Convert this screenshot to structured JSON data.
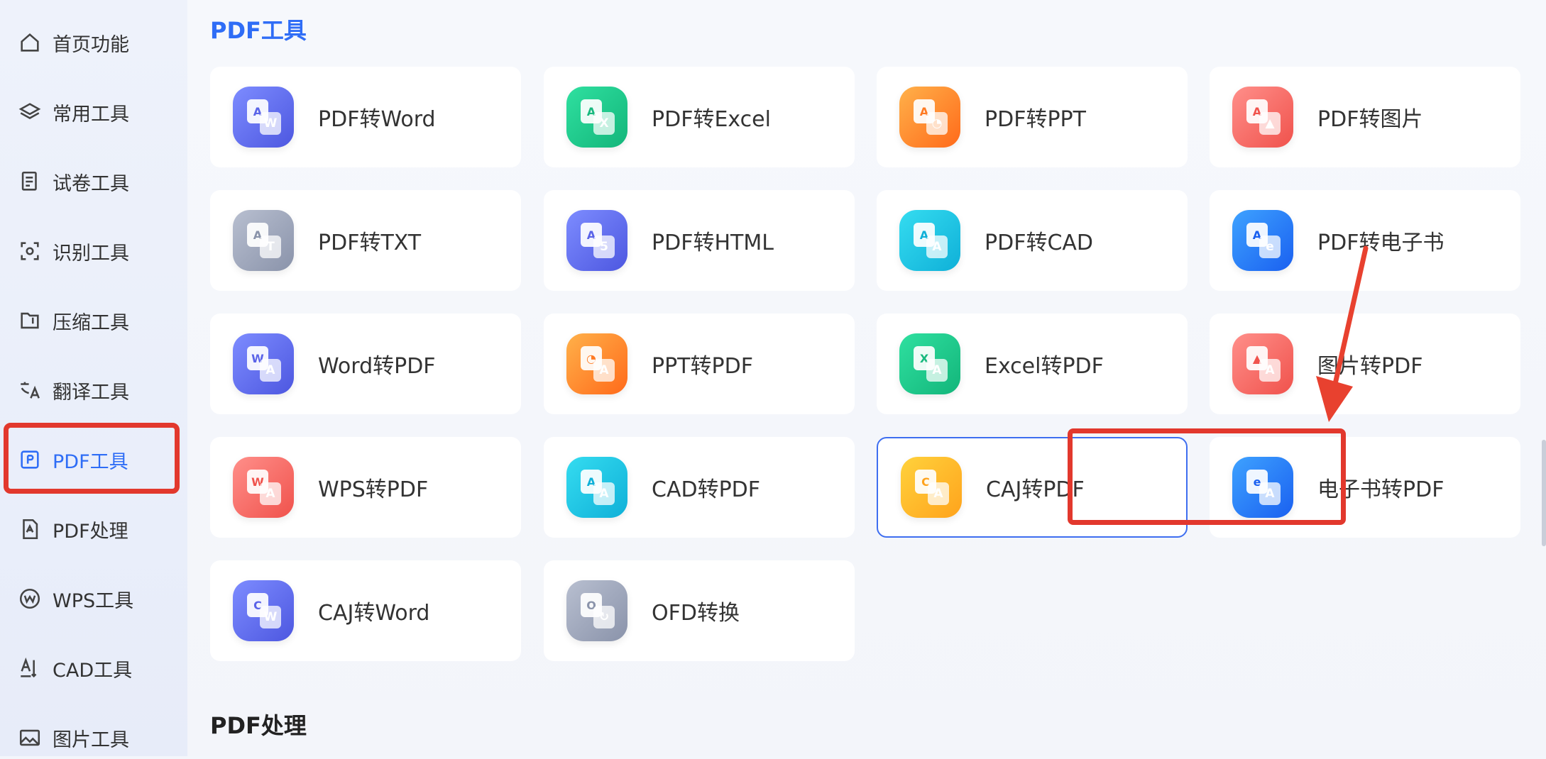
{
  "sidebar": {
    "items": [
      {
        "label": "首页功能",
        "icon": "home-icon"
      },
      {
        "label": "常用工具",
        "icon": "layers-icon"
      },
      {
        "label": "试卷工具",
        "icon": "exam-icon"
      },
      {
        "label": "识别工具",
        "icon": "scan-icon"
      },
      {
        "label": "压缩工具",
        "icon": "compress-icon"
      },
      {
        "label": "翻译工具",
        "icon": "translate-icon"
      },
      {
        "label": "PDF工具",
        "icon": "pdf-tool-icon",
        "active": true
      },
      {
        "label": "PDF处理",
        "icon": "pdf-process-icon"
      },
      {
        "label": "WPS工具",
        "icon": "wps-icon"
      },
      {
        "label": "CAD工具",
        "icon": "cad-icon"
      },
      {
        "label": "图片工具",
        "icon": "image-icon"
      }
    ]
  },
  "main": {
    "section1_title": "PDF工具",
    "section2_title": "PDF处理",
    "tools": [
      {
        "label": "PDF转Word",
        "icon": "pdf-to-word-icon",
        "color": "#6b75f5"
      },
      {
        "label": "PDF转Excel",
        "icon": "pdf-to-excel-icon",
        "color": "#1fc98e"
      },
      {
        "label": "PDF转PPT",
        "icon": "pdf-to-ppt-icon",
        "color": "#ff8a2a"
      },
      {
        "label": "PDF转图片",
        "icon": "pdf-to-image-icon",
        "color": "#f46b62"
      },
      {
        "label": "PDF转TXT",
        "icon": "pdf-to-txt-icon",
        "color": "#a0a8bd"
      },
      {
        "label": "PDF转HTML",
        "icon": "pdf-to-html-icon",
        "color": "#6b75f5"
      },
      {
        "label": "PDF转CAD",
        "icon": "pdf-to-cad-icon",
        "color": "#1fc6e4"
      },
      {
        "label": "PDF转电子书",
        "icon": "pdf-to-ebook-icon",
        "color": "#2a7cf8"
      },
      {
        "label": "Word转PDF",
        "icon": "word-to-pdf-icon",
        "color": "#6b75f5"
      },
      {
        "label": "PPT转PDF",
        "icon": "ppt-to-pdf-icon",
        "color": "#ff8a2a"
      },
      {
        "label": "Excel转PDF",
        "icon": "excel-to-pdf-icon",
        "color": "#1fc98e"
      },
      {
        "label": "图片转PDF",
        "icon": "image-to-pdf-icon",
        "color": "#f46b62"
      },
      {
        "label": "WPS转PDF",
        "icon": "wps-to-pdf-icon",
        "color": "#f46b62"
      },
      {
        "label": "CAD转PDF",
        "icon": "cad-to-pdf-icon",
        "color": "#1fc6e4"
      },
      {
        "label": "CAJ转PDF",
        "icon": "caj-to-pdf-icon",
        "color": "#ffbb2a",
        "selected": true
      },
      {
        "label": "电子书转PDF",
        "icon": "ebook-to-pdf-icon",
        "color": "#2a7cf8"
      },
      {
        "label": "CAJ转Word",
        "icon": "caj-to-word-icon",
        "color": "#6b75f5"
      },
      {
        "label": "OFD转换",
        "icon": "ofd-convert-icon",
        "color": "#a0a8bd"
      }
    ]
  },
  "annotation": {
    "highlight_color": "#e2382d"
  }
}
